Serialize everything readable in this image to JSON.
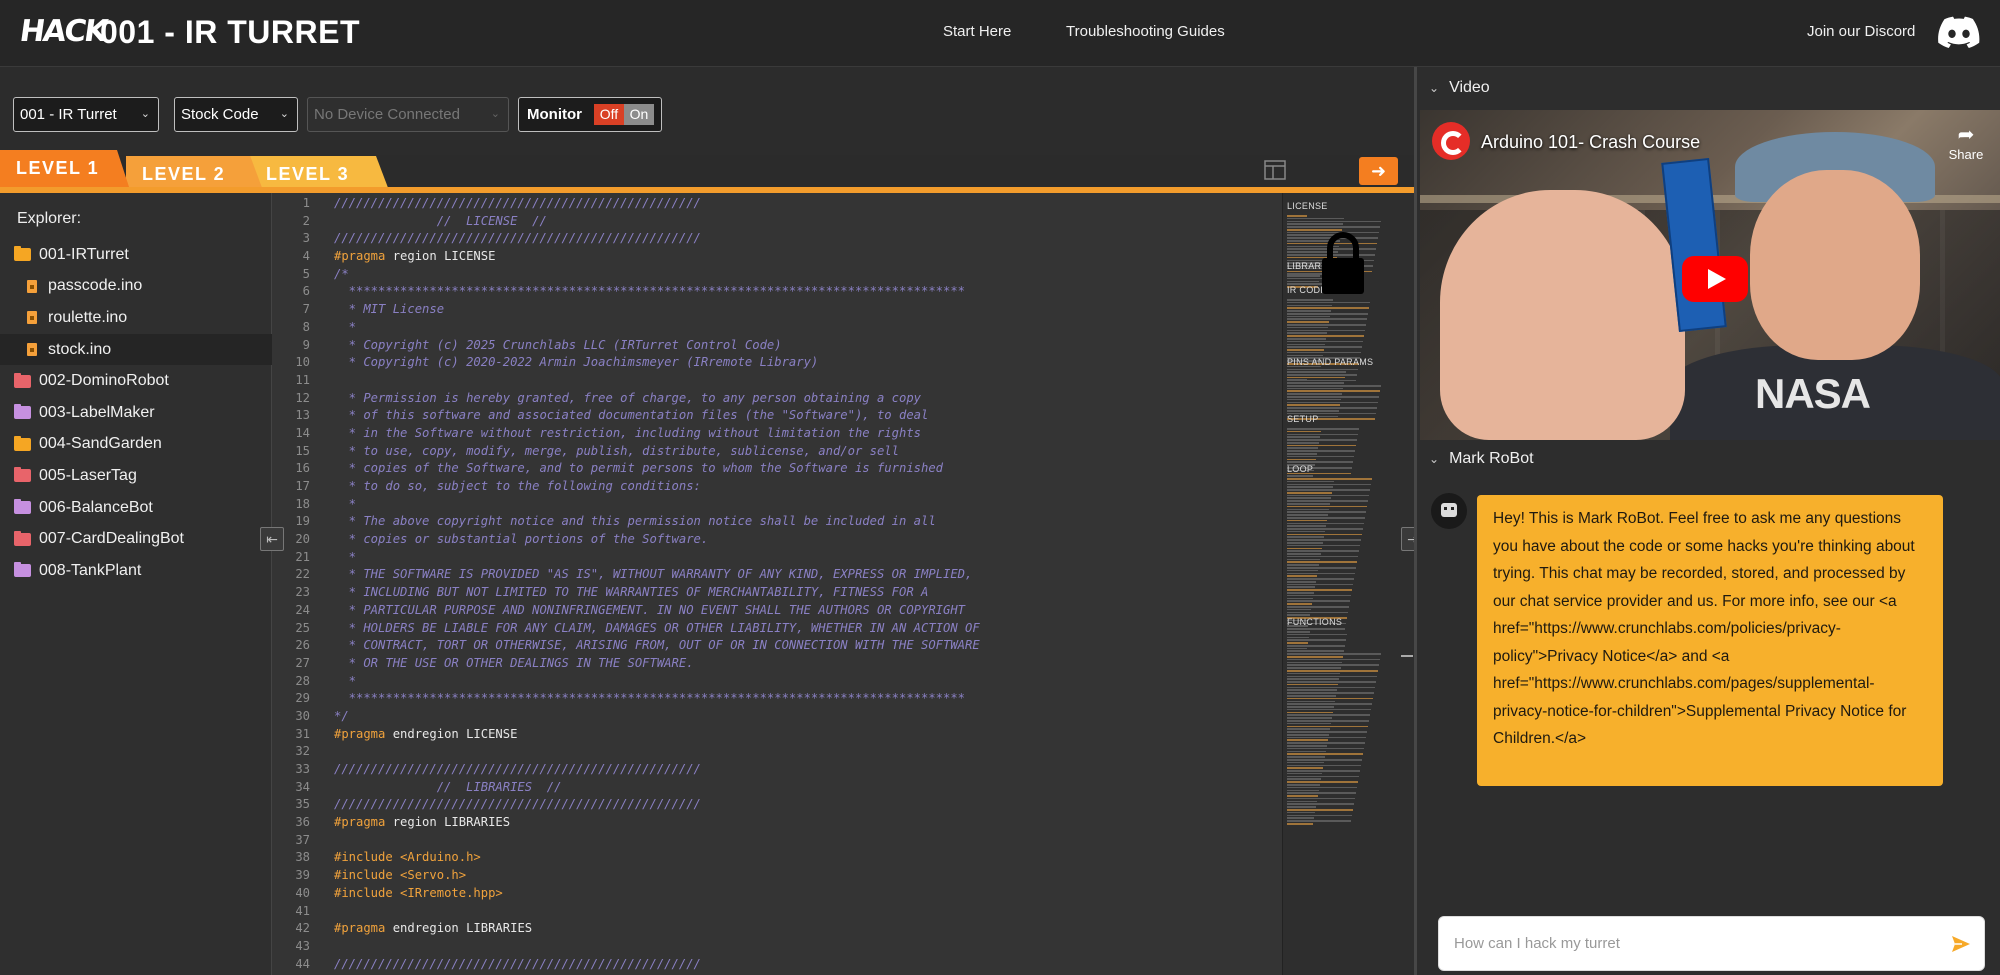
{
  "header": {
    "logo": "HACK",
    "title": "001 - IR TURRET",
    "nav": [
      "Start Here",
      "Troubleshooting Guides"
    ],
    "discord_label": "Join our Discord"
  },
  "toolbar": {
    "project_select": "001 - IR Turret",
    "code_select": "Stock Code",
    "device_select": "No Device Connected",
    "monitor_label": "Monitor",
    "toggle_off": "Off",
    "toggle_on": "On"
  },
  "levels": [
    "LEVEL 1",
    "LEVEL 2",
    "LEVEL 3"
  ],
  "run_button": "➜",
  "explorer": {
    "title": "Explorer:",
    "items": [
      {
        "label": "001-IRTurret",
        "type": "folder",
        "color": "#f5a623"
      },
      {
        "label": "passcode.ino",
        "type": "file"
      },
      {
        "label": "roulette.ino",
        "type": "file"
      },
      {
        "label": "stock.ino",
        "type": "file",
        "selected": true
      },
      {
        "label": "002-DominoRobot",
        "type": "folder",
        "color": "#e8646a"
      },
      {
        "label": "003-LabelMaker",
        "type": "folder",
        "color": "#c690e0"
      },
      {
        "label": "004-SandGarden",
        "type": "folder",
        "color": "#f5a623"
      },
      {
        "label": "005-LaserTag",
        "type": "folder",
        "color": "#e8646a"
      },
      {
        "label": "006-BalanceBot",
        "type": "folder",
        "color": "#c690e0"
      },
      {
        "label": "007-CardDealingBot",
        "type": "folder",
        "color": "#e8646a"
      },
      {
        "label": "008-TankPlant",
        "type": "folder",
        "color": "#c690e0"
      }
    ]
  },
  "code": [
    {
      "n": "1",
      "k": "c",
      "t": "//////////////////////////////////////////////////"
    },
    {
      "n": "2",
      "k": "c",
      "t": "              //  LICENSE  //"
    },
    {
      "n": "3",
      "k": "c",
      "t": "//////////////////////////////////////////////////"
    },
    {
      "n": "4",
      "k": "pt",
      "p": "#pragma",
      "t": " region LICENSE"
    },
    {
      "n": "5",
      "k": "c",
      "t": "/*"
    },
    {
      "n": "6",
      "k": "c",
      "t": "  ************************************************************************************"
    },
    {
      "n": "7",
      "k": "c",
      "t": "  * MIT License"
    },
    {
      "n": "8",
      "k": "c",
      "t": "  *"
    },
    {
      "n": "9",
      "k": "c",
      "t": "  * Copyright (c) 2025 Crunchlabs LLC (IRTurret Control Code)"
    },
    {
      "n": "10",
      "k": "c",
      "t": "  * Copyright (c) 2020-2022 Armin Joachimsmeyer (IRremote Library)"
    },
    {
      "n": "11",
      "k": "c",
      "t": ""
    },
    {
      "n": "12",
      "k": "c",
      "t": "  * Permission is hereby granted, free of charge, to any person obtaining a copy"
    },
    {
      "n": "13",
      "k": "c",
      "t": "  * of this software and associated documentation files (the \"Software\"), to deal"
    },
    {
      "n": "14",
      "k": "c",
      "t": "  * in the Software without restriction, including without limitation the rights"
    },
    {
      "n": "15",
      "k": "c",
      "t": "  * to use, copy, modify, merge, publish, distribute, sublicense, and/or sell"
    },
    {
      "n": "16",
      "k": "c",
      "t": "  * copies of the Software, and to permit persons to whom the Software is furnished"
    },
    {
      "n": "17",
      "k": "c",
      "t": "  * to do so, subject to the following conditions:"
    },
    {
      "n": "18",
      "k": "c",
      "t": "  *"
    },
    {
      "n": "19",
      "k": "c",
      "t": "  * The above copyright notice and this permission notice shall be included in all"
    },
    {
      "n": "20",
      "k": "c",
      "t": "  * copies or substantial portions of the Software."
    },
    {
      "n": "21",
      "k": "c",
      "t": "  *"
    },
    {
      "n": "22",
      "k": "c",
      "t": "  * THE SOFTWARE IS PROVIDED \"AS IS\", WITHOUT WARRANTY OF ANY KIND, EXPRESS OR IMPLIED,"
    },
    {
      "n": "23",
      "k": "c",
      "t": "  * INCLUDING BUT NOT LIMITED TO THE WARRANTIES OF MERCHANTABILITY, FITNESS FOR A"
    },
    {
      "n": "24",
      "k": "c",
      "t": "  * PARTICULAR PURPOSE AND NONINFRINGEMENT. IN NO EVENT SHALL THE AUTHORS OR COPYRIGHT"
    },
    {
      "n": "25",
      "k": "c",
      "t": "  * HOLDERS BE LIABLE FOR ANY CLAIM, DAMAGES OR OTHER LIABILITY, WHETHER IN AN ACTION OF"
    },
    {
      "n": "26",
      "k": "c",
      "t": "  * CONTRACT, TORT OR OTHERWISE, ARISING FROM, OUT OF OR IN CONNECTION WITH THE SOFTWARE"
    },
    {
      "n": "27",
      "k": "c",
      "t": "  * OR THE USE OR OTHER DEALINGS IN THE SOFTWARE."
    },
    {
      "n": "28",
      "k": "c",
      "t": "  *"
    },
    {
      "n": "29",
      "k": "c",
      "t": "  ************************************************************************************"
    },
    {
      "n": "30",
      "k": "c",
      "t": "*/"
    },
    {
      "n": "31",
      "k": "pt",
      "p": "#pragma",
      "t": " endregion LICENSE"
    },
    {
      "n": "32",
      "k": "c",
      "t": ""
    },
    {
      "n": "33",
      "k": "c",
      "t": "//////////////////////////////////////////////////"
    },
    {
      "n": "34",
      "k": "c",
      "t": "              //  LIBRARIES  //"
    },
    {
      "n": "35",
      "k": "c",
      "t": "//////////////////////////////////////////////////"
    },
    {
      "n": "36",
      "k": "pt",
      "p": "#pragma",
      "t": " region LIBRARIES"
    },
    {
      "n": "37",
      "k": "c",
      "t": ""
    },
    {
      "n": "38",
      "k": "pi",
      "p": "#include",
      "t": " <Arduino.h>"
    },
    {
      "n": "39",
      "k": "pi",
      "p": "#include",
      "t": " <Servo.h>"
    },
    {
      "n": "40",
      "k": "pi",
      "p": "#include",
      "t": " <IRremote.hpp>"
    },
    {
      "n": "41",
      "k": "c",
      "t": ""
    },
    {
      "n": "42",
      "k": "pt",
      "p": "#pragma",
      "t": " endregion LIBRARIES"
    },
    {
      "n": "43",
      "k": "c",
      "t": ""
    },
    {
      "n": "44",
      "k": "c",
      "t": "//////////////////////////////////////////////////"
    }
  ],
  "minimap": {
    "sections": [
      "LICENSE",
      "LIBRARI",
      "IR CODI",
      "PINS AND PARAMS",
      "SETUP",
      "LOOP",
      "FUNCTIONS"
    ]
  },
  "video": {
    "section_label": "Video",
    "title": "Arduino 101- Crash Course",
    "share_label": "Share"
  },
  "chat": {
    "section_label": "Mark RoBot",
    "message": "Hey! This is Mark RoBot. Feel free to ask me any questions you have about the code or some hacks you're thinking about trying. This chat may be recorded, stored, and processed by our chat service provider and us. For more info, see our <a href=\"https://www.crunchlabs.com/policies/privacy-policy\">Privacy Notice</a> and <a href=\"https://www.crunchlabs.com/pages/supplemental-privacy-notice-for-children\">Supplemental Privacy Notice for Children.</a>",
    "input_placeholder": "How can I hack my turret"
  },
  "colors": {
    "accent": "#f47e20",
    "bubble": "#f7b02c",
    "toggle_off": "#d94025"
  }
}
